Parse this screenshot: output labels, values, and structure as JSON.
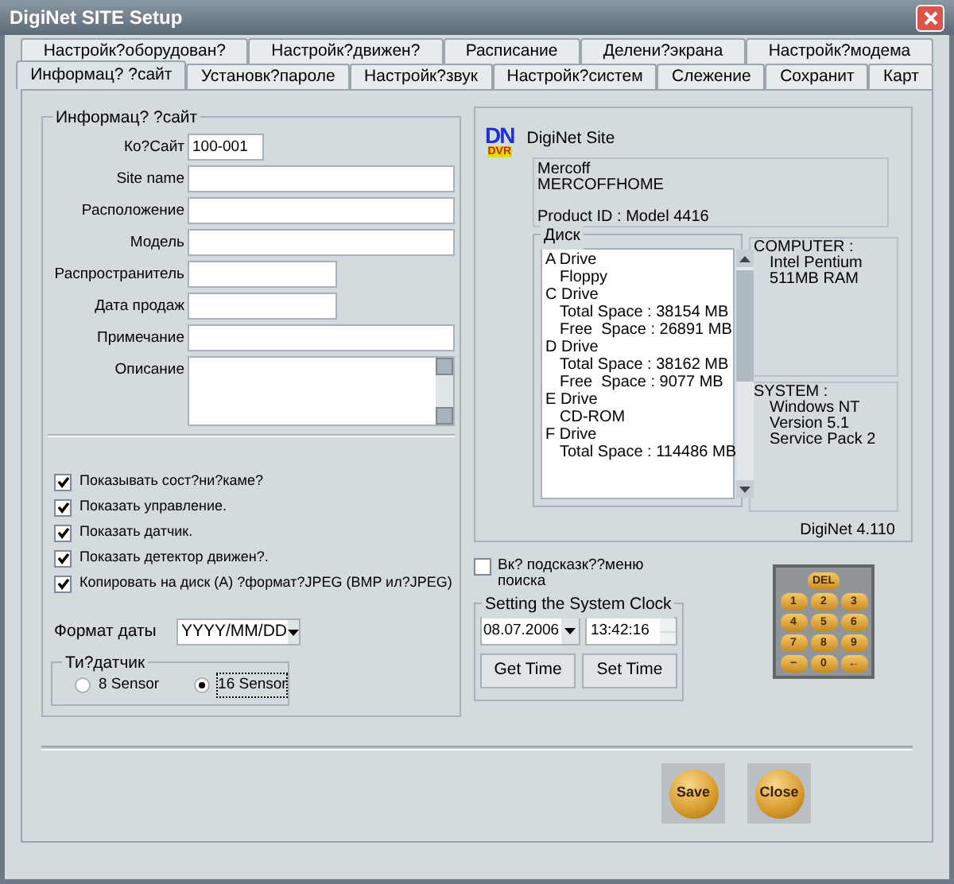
{
  "window": {
    "title": "DigiNet SITE Setup"
  },
  "tab_rows": [
    [
      {
        "label": "Настройк?оборудован?",
        "selected": false
      },
      {
        "label": "Настройк?движен?",
        "selected": false
      },
      {
        "label": "Расписание",
        "selected": false
      },
      {
        "label": "Делени?экрана",
        "selected": false
      },
      {
        "label": "Настройк?модема",
        "selected": false
      }
    ],
    [
      {
        "label": "Информац? ?сайт",
        "selected": true
      },
      {
        "label": "Установк?пароле",
        "selected": false
      },
      {
        "label": "Настройк?звук",
        "selected": false
      },
      {
        "label": "Настройк?систем",
        "selected": false
      },
      {
        "label": "Слежение",
        "selected": false
      },
      {
        "label": "Сохранит",
        "selected": false
      },
      {
        "label": "Карт",
        "selected": false
      }
    ]
  ],
  "site_info": {
    "title": "Информац? ?сайт",
    "fields": [
      {
        "label": "Ко?Сайт",
        "value": "100-001",
        "kind": "short"
      },
      {
        "label": "Site name",
        "kind": "wide"
      },
      {
        "label": "Расположение",
        "kind": "wide"
      },
      {
        "label": "Модель",
        "kind": "wide"
      },
      {
        "label": "Распространитель",
        "kind": "medium"
      },
      {
        "label": "Дата продаж",
        "kind": "medium"
      },
      {
        "label": "Примечание",
        "kind": "wide"
      },
      {
        "label": "Описание",
        "kind": "memo"
      }
    ],
    "checkboxes": [
      {
        "label": "Показывать сост?ни?каме?",
        "checked": true
      },
      {
        "label": "Показать управление.",
        "checked": true
      },
      {
        "label": "Показать датчик.",
        "checked": true
      },
      {
        "label": "Показать детектор движен?.",
        "checked": true
      },
      {
        "label": "Копировать на диск (A) ?формат?JPEG (BMP ил?JPEG)",
        "checked": true
      }
    ],
    "date_format": {
      "label": "Формат даты",
      "value": "YYYY/MM/DD"
    },
    "sensor_type": {
      "title": "Ти?датчик",
      "options": [
        {
          "label": "8 Sensor",
          "selected": false
        },
        {
          "label": "16 Sensor",
          "selected": true
        }
      ]
    }
  },
  "about": {
    "logo": {
      "top": "DN",
      "bottom": "DVR"
    },
    "product": "DigiNet Site",
    "info_lines": [
      "Mercoff",
      "MERCOFFHOME"
    ],
    "product_id": "Product ID : Model 4416",
    "disk": {
      "title": "Диск",
      "drives": [
        {
          "label": "A Drive",
          "children": [
            "Floppy"
          ]
        },
        {
          "label": "C Drive",
          "children": [
            "Total Space : 38154 MB",
            "Free  Space : 26891 MB"
          ]
        },
        {
          "label": "D Drive",
          "children": [
            "Total Space : 38162 MB",
            "Free  Space : 9077 MB"
          ]
        },
        {
          "label": "E Drive",
          "children": [
            "CD-ROM"
          ]
        },
        {
          "label": "F Drive",
          "children": [
            "Total Space : 114486 MB"
          ]
        }
      ]
    },
    "computer": {
      "title": "COMPUTER :",
      "lines": [
        "Intel Pentium",
        "511MB RAM"
      ]
    },
    "system": {
      "title": "SYSTEM :",
      "lines": [
        "Windows NT",
        "Version 5.1",
        "Service Pack 2"
      ]
    },
    "version": "DigiNet 4.110"
  },
  "tooltip_option": {
    "label": "Вк? подсказк??меню поиска",
    "checked": false
  },
  "clock": {
    "title": "Setting the System Clock",
    "date": "08.07.2006",
    "time": "13:42:16",
    "buttons": [
      "Get Time",
      "Set Time"
    ]
  },
  "keypad": {
    "top": "DEL",
    "keys": [
      "1",
      "2",
      "3",
      "4",
      "5",
      "6",
      "7",
      "8",
      "9",
      "−",
      "0",
      "←"
    ]
  },
  "footer_buttons": [
    "Save",
    "Close"
  ]
}
